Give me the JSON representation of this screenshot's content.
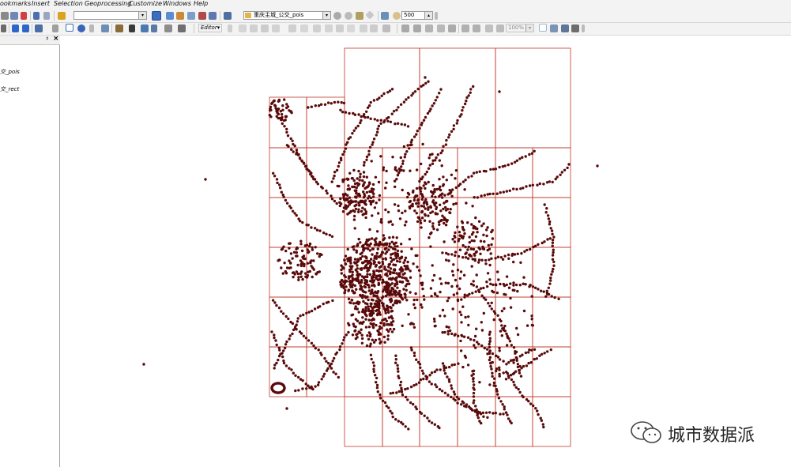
{
  "menu": {
    "items": [
      "ookmarks",
      "Insert",
      "Selection",
      "Geoprocessing",
      "Customize",
      "Windows",
      "Help"
    ]
  },
  "toolbar": {
    "layer_combo_value": "重庆主城_公交_pois",
    "scale_value": "500",
    "editor_label": "Editor▾",
    "zoom_value": "100%"
  },
  "toc": {
    "layers": [
      "交_pois",
      "交_rect"
    ]
  },
  "map": {
    "point_color": "#5a0a0a",
    "grid_color": "#c0392b"
  },
  "watermark": {
    "text": "城市数据派"
  }
}
